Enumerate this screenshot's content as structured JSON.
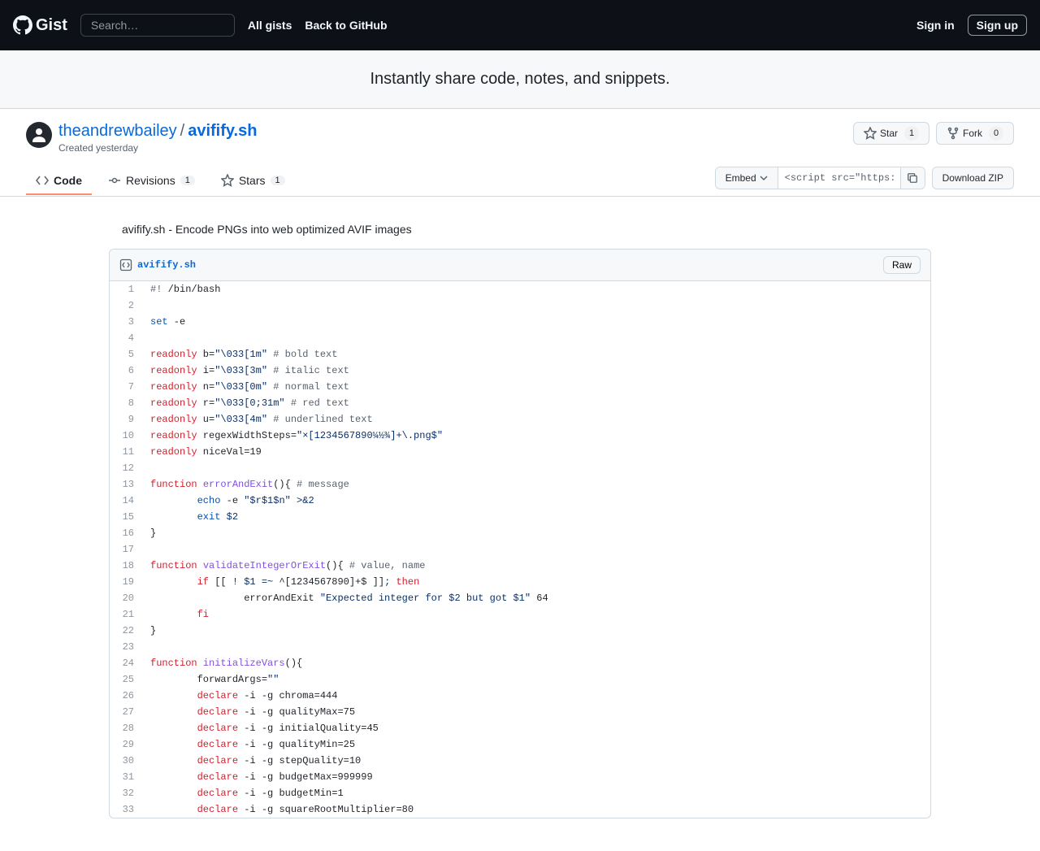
{
  "topbar": {
    "logo_text": "Gist",
    "search_placeholder": "Search…",
    "nav": {
      "all_gists": "All gists",
      "back_to_github": "Back to GitHub"
    },
    "signin": "Sign in",
    "signup": "Sign up"
  },
  "hero": {
    "text": "Instantly share code, notes, and snippets."
  },
  "gist": {
    "owner": "theandrewbailey",
    "filename": "avifify.sh",
    "created": "Created yesterday",
    "description": "avifify.sh - Encode PNGs into web optimized AVIF images"
  },
  "actions": {
    "star_label": "Star",
    "star_count": "1",
    "fork_label": "Fork",
    "fork_count": "0"
  },
  "tabs": {
    "code": "Code",
    "revisions": "Revisions",
    "revisions_count": "1",
    "stars": "Stars",
    "stars_count": "1"
  },
  "embed": {
    "label": "Embed",
    "url": "<script src=\"https:/",
    "download": "Download ZIP"
  },
  "file": {
    "name": "avifify.sh",
    "raw_label": "Raw"
  },
  "code": [
    {
      "n": "1",
      "t": [
        [
          "comment",
          "#!"
        ],
        [
          "plain",
          " /bin/bash"
        ]
      ]
    },
    {
      "n": "2",
      "t": []
    },
    {
      "n": "3",
      "t": [
        [
          "builtin",
          "set"
        ],
        [
          "plain",
          " -e"
        ]
      ]
    },
    {
      "n": "4",
      "t": []
    },
    {
      "n": "5",
      "t": [
        [
          "keyword",
          "readonly"
        ],
        [
          "plain",
          " b="
        ],
        [
          "string",
          "\"\\033[1m\""
        ],
        [
          "plain",
          " "
        ],
        [
          "comment",
          "# bold text"
        ]
      ]
    },
    {
      "n": "6",
      "t": [
        [
          "keyword",
          "readonly"
        ],
        [
          "plain",
          " i="
        ],
        [
          "string",
          "\"\\033[3m\""
        ],
        [
          "plain",
          " "
        ],
        [
          "comment",
          "# italic text"
        ]
      ]
    },
    {
      "n": "7",
      "t": [
        [
          "keyword",
          "readonly"
        ],
        [
          "plain",
          " n="
        ],
        [
          "string",
          "\"\\033[0m\""
        ],
        [
          "plain",
          " "
        ],
        [
          "comment",
          "# normal text"
        ]
      ]
    },
    {
      "n": "8",
      "t": [
        [
          "keyword",
          "readonly"
        ],
        [
          "plain",
          " r="
        ],
        [
          "string",
          "\"\\033[0;31m\""
        ],
        [
          "plain",
          " "
        ],
        [
          "comment",
          "# red text"
        ]
      ]
    },
    {
      "n": "9",
      "t": [
        [
          "keyword",
          "readonly"
        ],
        [
          "plain",
          " u="
        ],
        [
          "string",
          "\"\\033[4m\""
        ],
        [
          "plain",
          " "
        ],
        [
          "comment",
          "# underlined text"
        ]
      ]
    },
    {
      "n": "10",
      "t": [
        [
          "keyword",
          "readonly"
        ],
        [
          "plain",
          " regexWidthSteps="
        ],
        [
          "string",
          "\"×[1234567890¼½¾]+\\.png$\""
        ]
      ]
    },
    {
      "n": "11",
      "t": [
        [
          "keyword",
          "readonly"
        ],
        [
          "plain",
          " niceVal=19"
        ]
      ]
    },
    {
      "n": "12",
      "t": []
    },
    {
      "n": "13",
      "t": [
        [
          "keyword",
          "function"
        ],
        [
          "plain",
          " "
        ],
        [
          "func",
          "errorAndExit"
        ],
        [
          "plain",
          "(){ "
        ],
        [
          "comment",
          "# message"
        ]
      ]
    },
    {
      "n": "14",
      "t": [
        [
          "plain",
          "        "
        ],
        [
          "builtin",
          "echo"
        ],
        [
          "plain",
          " -e "
        ],
        [
          "string",
          "\"$r$1$n\""
        ],
        [
          "plain",
          " "
        ],
        [
          "op",
          ">&2"
        ]
      ]
    },
    {
      "n": "15",
      "t": [
        [
          "plain",
          "        "
        ],
        [
          "builtin",
          "exit"
        ],
        [
          "plain",
          " "
        ],
        [
          "op",
          "$2"
        ]
      ]
    },
    {
      "n": "16",
      "t": [
        [
          "plain",
          "}"
        ]
      ]
    },
    {
      "n": "17",
      "t": []
    },
    {
      "n": "18",
      "t": [
        [
          "keyword",
          "function"
        ],
        [
          "plain",
          " "
        ],
        [
          "func",
          "validateIntegerOrExit"
        ],
        [
          "plain",
          "(){ "
        ],
        [
          "comment",
          "# value, name"
        ]
      ]
    },
    {
      "n": "19",
      "t": [
        [
          "plain",
          "        "
        ],
        [
          "keyword",
          "if"
        ],
        [
          "plain",
          " [[ "
        ],
        [
          "op",
          "!"
        ],
        [
          "plain",
          " "
        ],
        [
          "op",
          "$1"
        ],
        [
          "plain",
          " "
        ],
        [
          "op",
          "=~"
        ],
        [
          "plain",
          " ^[1234567890]+$ ]]"
        ],
        [
          "op",
          ";"
        ],
        [
          "plain",
          " "
        ],
        [
          "keyword",
          "then"
        ]
      ]
    },
    {
      "n": "20",
      "t": [
        [
          "plain",
          "                errorAndExit "
        ],
        [
          "string",
          "\"Expected integer for $2 but got $1\""
        ],
        [
          "plain",
          " 64"
        ]
      ]
    },
    {
      "n": "21",
      "t": [
        [
          "plain",
          "        "
        ],
        [
          "keyword",
          "fi"
        ]
      ]
    },
    {
      "n": "22",
      "t": [
        [
          "plain",
          "}"
        ]
      ]
    },
    {
      "n": "23",
      "t": []
    },
    {
      "n": "24",
      "t": [
        [
          "keyword",
          "function"
        ],
        [
          "plain",
          " "
        ],
        [
          "func",
          "initializeVars"
        ],
        [
          "plain",
          "(){"
        ]
      ]
    },
    {
      "n": "25",
      "t": [
        [
          "plain",
          "        forwardArgs="
        ],
        [
          "string",
          "\"\""
        ]
      ]
    },
    {
      "n": "26",
      "t": [
        [
          "plain",
          "        "
        ],
        [
          "keyword",
          "declare"
        ],
        [
          "plain",
          " -i -g chroma=444"
        ]
      ]
    },
    {
      "n": "27",
      "t": [
        [
          "plain",
          "        "
        ],
        [
          "keyword",
          "declare"
        ],
        [
          "plain",
          " -i -g qualityMax=75"
        ]
      ]
    },
    {
      "n": "28",
      "t": [
        [
          "plain",
          "        "
        ],
        [
          "keyword",
          "declare"
        ],
        [
          "plain",
          " -i -g initialQuality=45"
        ]
      ]
    },
    {
      "n": "29",
      "t": [
        [
          "plain",
          "        "
        ],
        [
          "keyword",
          "declare"
        ],
        [
          "plain",
          " -i -g qualityMin=25"
        ]
      ]
    },
    {
      "n": "30",
      "t": [
        [
          "plain",
          "        "
        ],
        [
          "keyword",
          "declare"
        ],
        [
          "plain",
          " -i -g stepQuality=10"
        ]
      ]
    },
    {
      "n": "31",
      "t": [
        [
          "plain",
          "        "
        ],
        [
          "keyword",
          "declare"
        ],
        [
          "plain",
          " -i -g budgetMax=999999"
        ]
      ]
    },
    {
      "n": "32",
      "t": [
        [
          "plain",
          "        "
        ],
        [
          "keyword",
          "declare"
        ],
        [
          "plain",
          " -i -g budgetMin=1"
        ]
      ]
    },
    {
      "n": "33",
      "t": [
        [
          "plain",
          "        "
        ],
        [
          "keyword",
          "declare"
        ],
        [
          "plain",
          " -i -g squareRootMultiplier=80"
        ]
      ]
    }
  ]
}
